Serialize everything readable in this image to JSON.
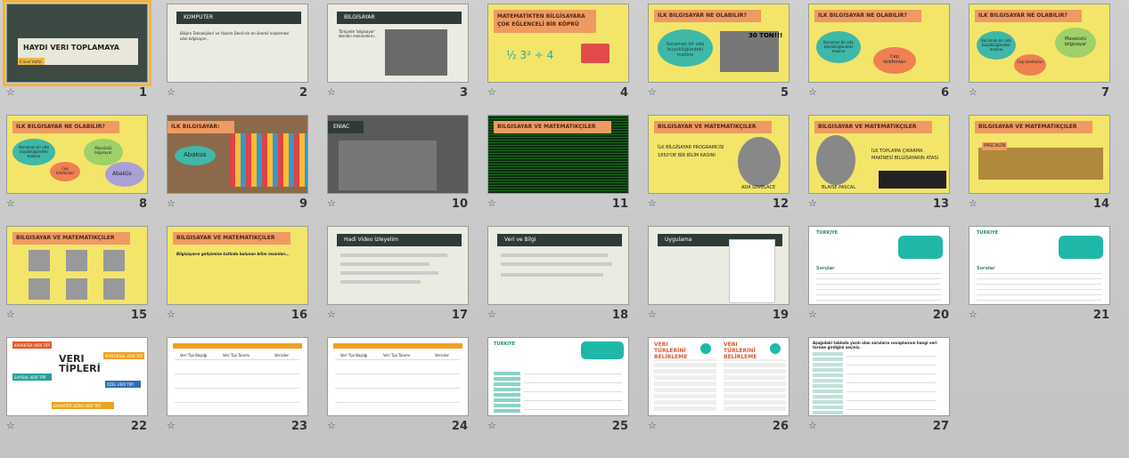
{
  "colors": {
    "selection": "#f0b63e",
    "yellow_bg": "#f3e56a",
    "orange_banner": "#ef9a63",
    "dark_bar": "#2f3b36",
    "teal": "#3fb8a8"
  },
  "slides": [
    {
      "number": "1",
      "title": "HAYDİ VERİ TOPLAMAYA",
      "subtitle": "6.Sınıf Hafta"
    },
    {
      "number": "2",
      "title": "KOMPÜTER",
      "body": "Bilişim Teknolojileri ve Yazılım Dersi'nin en önemli malzemesi olan bilgisayar..."
    },
    {
      "number": "3",
      "title": "BİLGİSAYAR",
      "body": "Türkçede 'bilgisayar' denilen makinelerin..."
    },
    {
      "number": "4",
      "title": "MATEMATİKTEN BİLGİSAYARA ÇOK EĞLENCELİ BİR KÖPRÜ"
    },
    {
      "number": "5",
      "title": "İLK BİLGİSAYAR NE OLABİLİR?",
      "bubble": "Kocaman bir oda büyüklüğündeki makine",
      "caption": "30 TON!!!"
    },
    {
      "number": "6",
      "title": "İLK BİLGİSAYAR NE OLABİLİR?",
      "bubble1": "Kocaman bir oda büyüklüğündeki makine",
      "bubble2": "Cep telefonları"
    },
    {
      "number": "7",
      "title": "İLK BİLGİSAYAR NE OLABİLİR?",
      "bubble1": "Kocaman bir oda büyüklüğündeki makine",
      "bubble2": "Masaüstü bilgisayar",
      "bubble3": "Cep telefonları"
    },
    {
      "number": "8",
      "title": "İLK BİLGİSAYAR NE OLABİLİR?",
      "bubble1": "Kocaman bir oda büyüklüğündeki makine",
      "bubble2": "Masaüstü bilgisayar",
      "bubble3": "Cep telefonları",
      "bubble4": "Abaküs"
    },
    {
      "number": "9",
      "title": "İLK BİLGİSAYAR:",
      "label": "Abaküs"
    },
    {
      "number": "10",
      "title": "ENIAC"
    },
    {
      "number": "11",
      "title": "BİLGİSAYAR VE MATEMATİKÇİLER"
    },
    {
      "number": "12",
      "title": "BİLGİSAYAR VE MATEMATİKÇİLER",
      "subtitle": "İLK BİLGİSAYAR PROGRAMCISI 1850'DE BİR BİLİM KADINI",
      "name": "ADA LOVELACE"
    },
    {
      "number": "13",
      "title": "BİLGİSAYAR VE MATEMATİKÇİLER",
      "subtitle": "İLK TOPLAMA ÇIKARMA MAKİNESİ BİLGİSAYARIN ATASI",
      "name": "BLAISE PASCAL"
    },
    {
      "number": "14",
      "title": "BİLGİSAYAR VE MATEMATİKÇİLER",
      "label": "PASCALİN"
    },
    {
      "number": "15",
      "title": "BİLGİSAYAR VE MATEMATİKÇİLER"
    },
    {
      "number": "16",
      "title": "BİLGİSAYAR VE MATEMATİKÇİLER",
      "body": "Bilgisayarın gelişimine katkıda bulunan bilim insanları..."
    },
    {
      "number": "17",
      "title": "Hadi Video İzleyelim"
    },
    {
      "number": "18",
      "title": "Veri ve Bilgi"
    },
    {
      "number": "19",
      "title": "Uygulama"
    },
    {
      "number": "20",
      "title": "TÜRKİYE",
      "subtitle": "Sorular"
    },
    {
      "number": "21",
      "title": "TÜRKİYE",
      "subtitle": "Sorular"
    },
    {
      "number": "22",
      "title": "VERİ TİPLERİ",
      "types": [
        "KARAKTER VERİ TİPİ",
        "MANTIKSAL VERİ TİPİ",
        "SAYISAL VERİ TİPİ",
        "ÖZEL VERİ TİPİ",
        "KARAKTER DİZİSİ VERİ TİPİ"
      ]
    },
    {
      "number": "23",
      "columns": [
        "Veri Tipi Başlığı",
        "Veri Tipi Tanımı",
        "Verisiler"
      ]
    },
    {
      "number": "24",
      "columns": [
        "Veri Tipi Başlığı",
        "Veri Tipi Tanımı",
        "Verisiler"
      ]
    },
    {
      "number": "25",
      "title": "TÜRKİYE"
    },
    {
      "number": "26",
      "title": "VERİ TÜRLERİNİ BELİRLEME"
    },
    {
      "number": "27",
      "title": "Aşağıdaki tabloda yazılı olan soruların cevaplarının hangi veri türüne girdiğini seçiniz."
    }
  ]
}
